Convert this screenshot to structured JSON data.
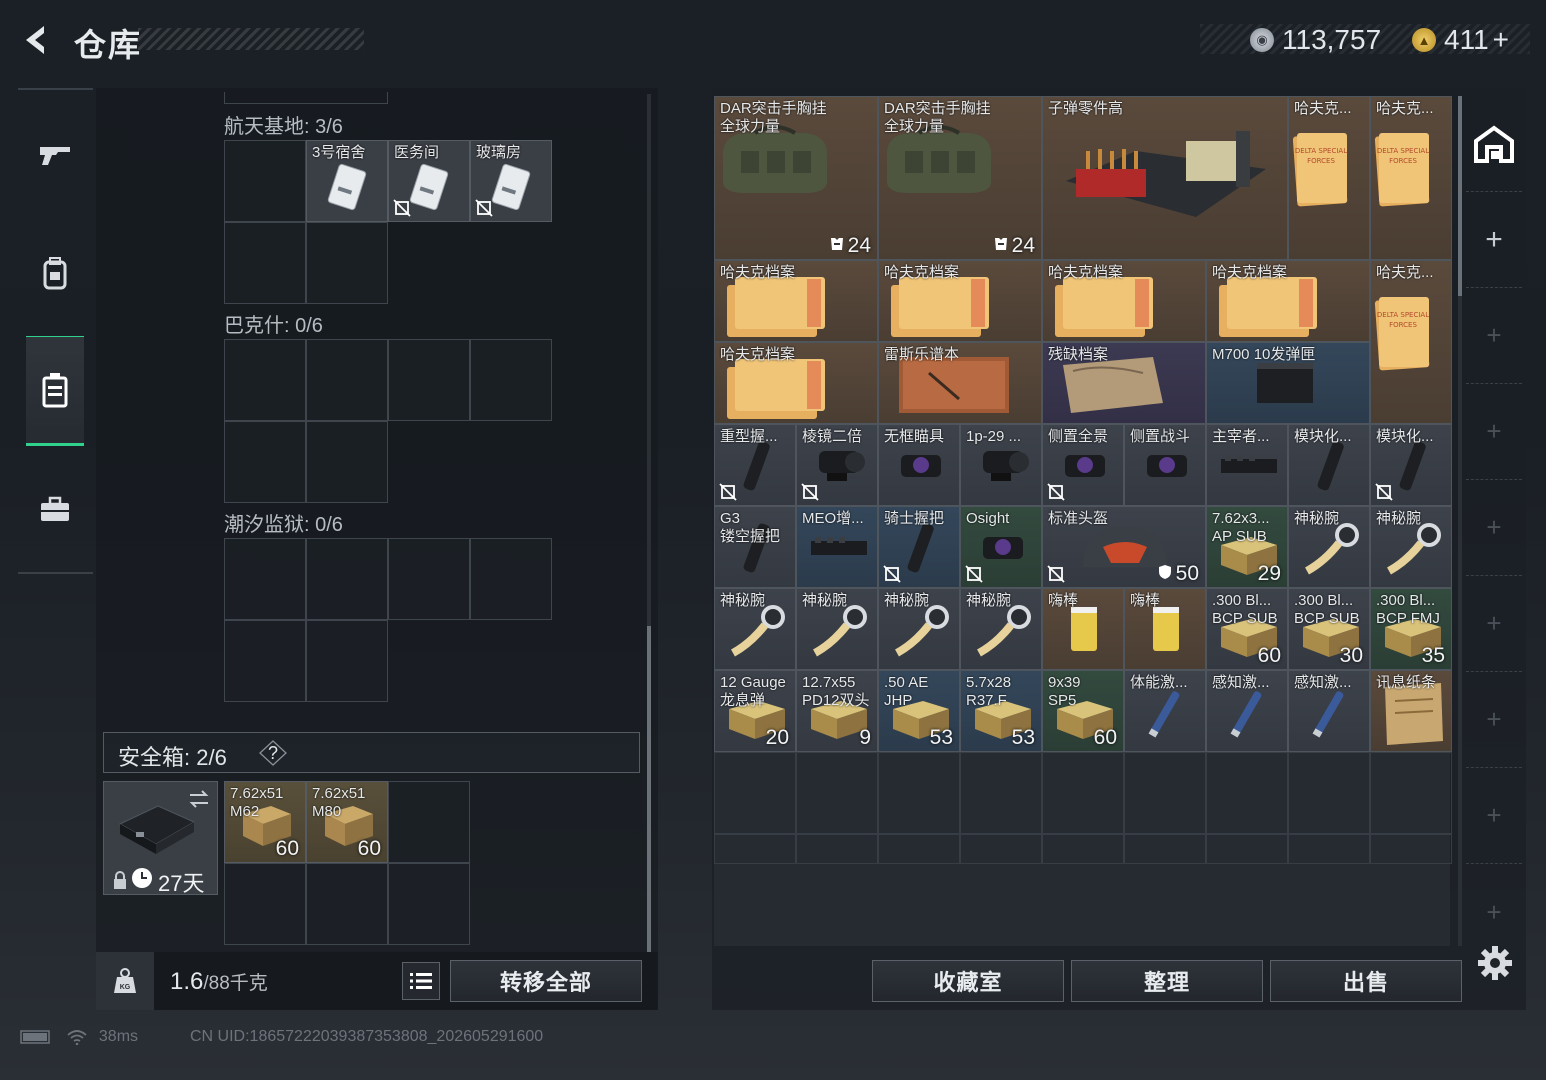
{
  "header": {
    "title": "仓库",
    "currencies": [
      {
        "icon": "silver-coin-icon",
        "value": "113,757"
      },
      {
        "icon": "gold-triangle-coin-icon",
        "value": "411"
      }
    ],
    "add_label": "+"
  },
  "sidebar": {
    "tabs": [
      {
        "icon": "gun-icon",
        "active": false
      },
      {
        "icon": "backpack-icon",
        "active": false
      },
      {
        "icon": "case-icon",
        "active": true
      },
      {
        "icon": "toolbox-icon",
        "active": false
      }
    ]
  },
  "left_panel": {
    "sections": [
      {
        "label": "航天基地: 3/6",
        "items": [
          {
            "name": "3号宿舍"
          },
          {
            "name": "医务间"
          },
          {
            "name": "玻璃房"
          }
        ]
      },
      {
        "label": "巴克什: 0/6",
        "items": []
      },
      {
        "label": "潮汐监狱: 0/6",
        "items": []
      }
    ],
    "safe_box": {
      "label": "安全箱:",
      "count": "2/6",
      "help": "?",
      "timer": "27天",
      "items": [
        {
          "name_line1": "7.62x51",
          "name_line2": "M62",
          "count": "60"
        },
        {
          "name_line1": "7.62x51",
          "name_line2": "M80",
          "count": "60"
        }
      ]
    },
    "weight": {
      "value": "1.6",
      "max": "/88千克"
    },
    "transfer_all": "转移全部"
  },
  "stash": {
    "items": [
      {
        "name": "DAR突击手胸挂",
        "sub": "全球力量",
        "count": "24",
        "bg": "brown"
      },
      {
        "name": "DAR突击手胸挂",
        "sub": "全球力量",
        "count": "24",
        "bg": "brown"
      },
      {
        "name": "子弹零件高",
        "bg": "brown"
      },
      {
        "name": "哈夫克...",
        "bg": "brown"
      },
      {
        "name": "哈夫克...",
        "bg": "brown"
      },
      {
        "name": "哈夫克档案",
        "bg": "brown"
      },
      {
        "name": "哈夫克档案",
        "bg": "brown"
      },
      {
        "name": "哈夫克档案",
        "bg": "brown"
      },
      {
        "name": "哈夫克档案",
        "bg": "brown"
      },
      {
        "name": "哈夫克...",
        "bg": "brown"
      },
      {
        "name": "哈夫克档案",
        "bg": "brown"
      },
      {
        "name": "雷斯乐谱本",
        "bg": "brown"
      },
      {
        "name": "残缺档案",
        "bg": "purple"
      },
      {
        "name": "M700 10发弹匣",
        "bg": "blue"
      },
      {
        "name": "重型握...",
        "bg": "gray"
      },
      {
        "name": "棱镜二倍",
        "bg": "gray"
      },
      {
        "name": "无框瞄具",
        "bg": "gray"
      },
      {
        "name": "1p-29 ...",
        "bg": "gray"
      },
      {
        "name": "侧置全景",
        "bg": "gray"
      },
      {
        "name": "侧置战斗",
        "bg": "gray"
      },
      {
        "name": "主宰者...",
        "bg": "gray"
      },
      {
        "name": "模块化...",
        "bg": "gray"
      },
      {
        "name": "模块化...",
        "bg": "gray"
      },
      {
        "name": "G3",
        "sub": "镂空握把",
        "bg": "gray"
      },
      {
        "name": "MEO增...",
        "bg": "blue"
      },
      {
        "name": "骑士握把",
        "bg": "blue"
      },
      {
        "name": "Osight",
        "bg": "green"
      },
      {
        "name": "标准头盔",
        "count": "50",
        "bg": "gray"
      },
      {
        "name": "7.62x3...",
        "sub": "AP SUB",
        "count": "29",
        "bg": "green"
      },
      {
        "name": "神秘腕",
        "bg": "gray"
      },
      {
        "name": "神秘腕",
        "bg": "gray"
      },
      {
        "name": "神秘腕",
        "bg": "gray"
      },
      {
        "name": "神秘腕",
        "bg": "gray"
      },
      {
        "name": "神秘腕",
        "bg": "gray"
      },
      {
        "name": "神秘腕",
        "bg": "gray"
      },
      {
        "name": "嗨棒",
        "bg": "brown"
      },
      {
        "name": "嗨棒",
        "bg": "brown"
      },
      {
        "name": ".300 Bl...",
        "sub": "BCP SUB",
        "count": "60",
        "bg": "gray"
      },
      {
        "name": ".300 Bl...",
        "sub": "BCP SUB",
        "count": "30",
        "bg": "gray"
      },
      {
        "name": ".300 Bl...",
        "sub": "BCP FMJ",
        "count": "35",
        "bg": "green"
      },
      {
        "name": "12 Gauge",
        "sub": "龙息弹",
        "count": "20",
        "bg": "gray"
      },
      {
        "name": "12.7x55",
        "sub": "PD12双头",
        "count": "9",
        "bg": "gray"
      },
      {
        "name": ".50 AE",
        "sub": "JHP",
        "count": "53",
        "bg": "blue"
      },
      {
        "name": "5.7x28",
        "sub": "R37.F",
        "count": "53",
        "bg": "blue"
      },
      {
        "name": "9x39",
        "sub": "SP5",
        "count": "60",
        "bg": "green"
      },
      {
        "name": "体能激...",
        "bg": "gray"
      },
      {
        "name": "感知激...",
        "bg": "gray"
      },
      {
        "name": "感知激...",
        "bg": "gray"
      },
      {
        "name": "讯息纸条",
        "bg": "brown"
      }
    ]
  },
  "actions": {
    "collection": "收藏室",
    "sort": "整理",
    "sell": "出售"
  },
  "status": {
    "ping": "38ms",
    "uid": "CN UID:18657222039387353808_202605291600"
  }
}
